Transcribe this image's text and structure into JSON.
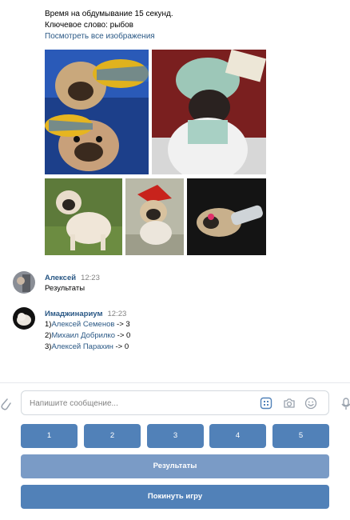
{
  "bot_message": {
    "line1": "Время на обдумывание 15 секунд.",
    "line2": "Ключевое слово: рыбов",
    "link": "Посмотреть все изображения"
  },
  "images": [
    {
      "name": "pug-fish-image"
    },
    {
      "name": "pug-doctor-image"
    },
    {
      "name": "pug-grass-image"
    },
    {
      "name": "pug-costume-image"
    },
    {
      "name": "pug-bottle-image"
    }
  ],
  "messages": [
    {
      "author": "Алексей",
      "time": "12:23",
      "text": "Результаты"
    },
    {
      "author": "Имаджинариум",
      "time": "12:23",
      "results": [
        {
          "prefix": "1)",
          "name": "Алексей Семенов",
          "suffix": " -> 3"
        },
        {
          "prefix": "2)",
          "name": "Михаил Добрилко",
          "suffix": " -> 0"
        },
        {
          "prefix": "3)",
          "name": "Алексей Парахин",
          "suffix": " -> 0"
        }
      ]
    }
  ],
  "composer": {
    "placeholder": "Напишите сообщение...",
    "icons": [
      "paperclip-icon",
      "keyboard-icon",
      "camera-icon",
      "smile-icon",
      "microphone-icon"
    ]
  },
  "keyboard": {
    "number_buttons": [
      "1",
      "2",
      "3",
      "4",
      "5"
    ],
    "results_label": "Результаты",
    "leave_label": "Покинуть игру"
  },
  "colors": {
    "accent": "#5181b8",
    "accent_light": "#7a9bc6",
    "link": "#2a5885",
    "muted": "#828282"
  }
}
